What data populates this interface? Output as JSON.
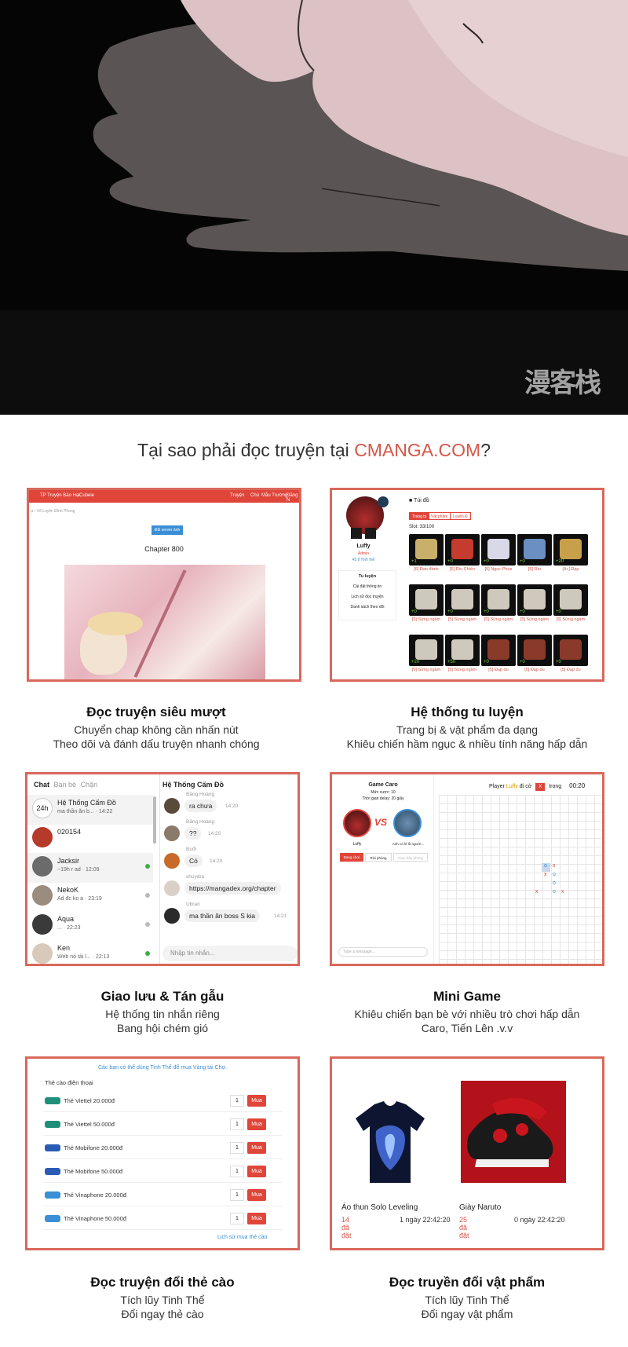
{
  "hero": {
    "watermark": "漫客栈"
  },
  "headline": {
    "prefix": "Tại sao phải đọc truyện tại ",
    "brand": "CMANGA.COM",
    "suffix": "?"
  },
  "features": [
    {
      "title": "Đọc truyện siêu mượt",
      "line1": "Chuyển chap không cần nhấn nút",
      "line2": "Theo dõi và đánh dấu truyện nhanh chóng"
    },
    {
      "title": "Hệ thống tu luyện",
      "line1": "Trang bị & vật phẩm đa dạng",
      "line2": "Khiêu chiến hầm ngục & nhiều tính năng hấp dẫn"
    },
    {
      "title": "Giao lưu & Tán gẫu",
      "line1": "Hệ thống tin nhắn riêng",
      "line2": "Bang hội chém gió"
    },
    {
      "title": "Mini Game",
      "line1": "Khiêu chiến bạn bè với nhiều trò chơi hấp dẫn",
      "line2": "Caro, Tiến Lên .v.v"
    },
    {
      "title": "Đọc truyện đổi thẻ cào",
      "line1": "Tích lũy Tinh Thể",
      "line2": "Đổi ngay thẻ cào"
    },
    {
      "title": "Đọc truyền đổi vật phẩm",
      "line1": "Tích lũy Tinh Thể",
      "line2": "Đổi ngay vật phẩm"
    }
  ],
  "reader": {
    "nav_left": [
      "TP Truyện Bảo Hại",
      "Cubeie"
    ],
    "nav_right": [
      "Truyện",
      "Chú",
      "Mẫu Trường",
      "Đăng N"
    ],
    "breadcrumb": "ự › Võ Luyện Đỉnh Phong",
    "server_button": "Đổi server ảnh",
    "chapter": "Chapter 800"
  },
  "cultivation": {
    "username": "Luffy",
    "role": "Admin",
    "power": "45 tỉ Tinh thể",
    "menu": [
      "Tu luyện",
      "Cài đặt thông tin",
      "Lịch sử đọc truyện",
      "Danh sách theo dõi"
    ],
    "bag_title": "Túi đồ",
    "bag_tabs": [
      "Trang bị",
      "Vật phẩm",
      "Luyện Đ"
    ],
    "slot": "Slot: 33/100",
    "row1": [
      {
        "lv": "+1",
        "label": "[6] Đao đánh"
      },
      {
        "lv": "+0",
        "label": "[6] Rìu Chiến"
      },
      {
        "lv": "+0",
        "label": "[5] Ngọc Phép"
      },
      {
        "lv": "+0",
        "label": "[6] Rìu"
      },
      {
        "lv": "+20",
        "label": "[4+] Đạp"
      }
    ],
    "row2": [
      {
        "lv": "+0",
        "label": "[5] Sừng ngầm"
      },
      {
        "lv": "+0",
        "label": "[5] Sừng ngầm"
      },
      {
        "lv": "+0",
        "label": "[5] Sừng ngầm"
      },
      {
        "lv": "+0",
        "label": "[5] Sừng ngầm"
      },
      {
        "lv": "+0",
        "label": "[5] Sừng ngầm"
      }
    ],
    "row3": [
      {
        "lv": "+20",
        "label": "[5] Sừng ngầm"
      },
      {
        "lv": "+50",
        "label": "[5] Sừng ngầm"
      },
      {
        "lv": "+0",
        "label": "[5] Đạp du"
      },
      {
        "lv": "+0",
        "label": "[5] Đạp du"
      },
      {
        "lv": "+0",
        "label": "[5] Đạp du"
      }
    ]
  },
  "chat": {
    "tabs": [
      "Chat",
      "Bạn bè",
      "Chặn"
    ],
    "conversations": [
      {
        "name": "Hệ Thống Cấm Đồ",
        "msg": "ma thần ăn b... · 14:22",
        "avatar": "24h"
      },
      {
        "name": "020154",
        "msg": "",
        "avatar": ""
      },
      {
        "name": "Jacksir",
        "msg": "~19h r ad · 12:09",
        "avatar": ""
      },
      {
        "name": "NekoK",
        "msg": "Ad đc ko a · 23:19",
        "avatar": ""
      },
      {
        "name": "Aqua",
        "msg": "... · 22:23",
        "avatar": ""
      },
      {
        "name": "Ken",
        "msg": "Web nó tải l... · 22:13",
        "avatar": ""
      }
    ],
    "room_title": "Hệ Thống Cấm Đồ",
    "messages": [
      {
        "user": "Băng Hoàng",
        "text": "ra chưa",
        "time": "14:20"
      },
      {
        "user": "Băng Hoàng",
        "text": "??",
        "time": "14:20"
      },
      {
        "user": "Buổi",
        "text": "Có",
        "time": "14:20"
      },
      {
        "user": "shuydra",
        "text": "https://mangadex.org/chapter",
        "time": ""
      },
      {
        "user": "Ubran",
        "text": "ma thần ăn boss S kia",
        "time": "14:21"
      }
    ],
    "input_placeholder": "Nhập tin nhắn..."
  },
  "minigame": {
    "title": "Game Caro",
    "bet": "Mức cược: 10",
    "delay": "Thời gian delay: 20 giây",
    "status_prefix": "Player ",
    "status_player": "Luffy",
    "status_mid": " đi cờ",
    "status_piece": "X",
    "status_suffix": "trong",
    "timer": "00:20",
    "p1_name": "Luffy",
    "p2_name": "Anh có lẻ là người...",
    "vs": "VS",
    "buttons": [
      "Đang chơi",
      "Rời phòng",
      "Giao đấu phòng"
    ],
    "message_placeholder": "Type a message..."
  },
  "topup": {
    "notice": "Các bạn có thể dùng Tinh Thể để mua Vàng tại Chợ.",
    "section": "Thẻ cào điện thoại",
    "cards": [
      {
        "name": "Thẻ Viettel 20.000đ",
        "qty": "1",
        "buy": "Mua",
        "brand": "viettel"
      },
      {
        "name": "Thẻ Viettel 50.000đ",
        "qty": "1",
        "buy": "Mua",
        "brand": "viettel"
      },
      {
        "name": "Thẻ Mobifone 20.000đ",
        "qty": "1",
        "buy": "Mua",
        "brand": "mobifone"
      },
      {
        "name": "Thẻ Mobifone 50.000đ",
        "qty": "1",
        "buy": "Mua",
        "brand": "mobifone"
      },
      {
        "name": "Thẻ Vinaphone 20.000đ",
        "qty": "1",
        "buy": "Mua",
        "brand": "vinaphone"
      },
      {
        "name": "Thẻ Vinaphone 50.000đ",
        "qty": "1",
        "buy": "Mua",
        "brand": "vinaphone"
      }
    ],
    "history_link": "Lịch sử mua thẻ cào"
  },
  "shop": {
    "items": [
      {
        "name": "Áo thun Solo Leveling",
        "count": "14 đã đặt",
        "time": "1 ngày 22:42:20"
      },
      {
        "name": "Giày Naruto",
        "count": "25 đã đặt",
        "time": "0 ngày 22:42:20"
      }
    ]
  },
  "colors": {
    "accent": "#d4574a",
    "border": "#d9685b",
    "buy": "#e0453a"
  }
}
